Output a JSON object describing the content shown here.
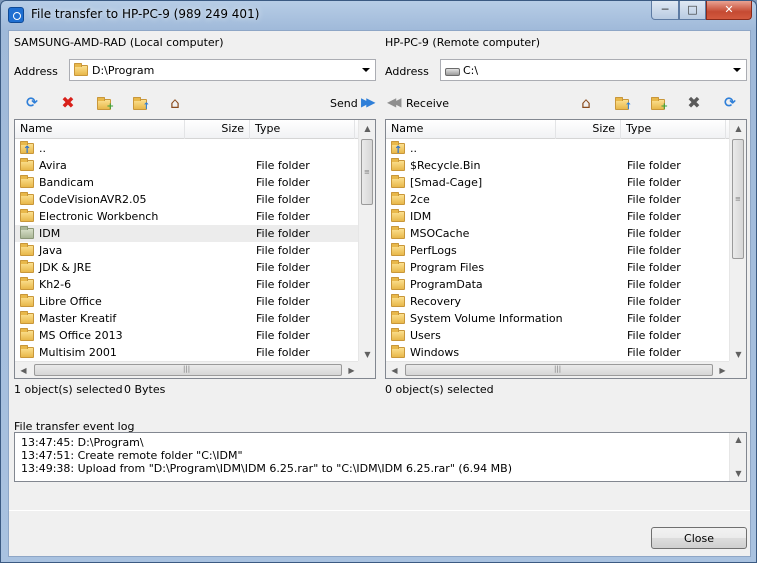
{
  "window": {
    "title": "File transfer to HP-PC-9 (989 249 401)"
  },
  "local": {
    "header": "SAMSUNG-AMD-RAD (Local computer)",
    "address_label": "Address",
    "address": "D:\\Program",
    "send_label": "Send",
    "columns": {
      "name": "Name",
      "size": "Size",
      "type": "Type"
    },
    "rows": [
      {
        "name": "..",
        "type": ""
      },
      {
        "name": "Avira",
        "type": "File folder"
      },
      {
        "name": "Bandicam",
        "type": "File folder"
      },
      {
        "name": "CodeVisionAVR2.05",
        "type": "File folder"
      },
      {
        "name": "Electronic Workbench",
        "type": "File folder"
      },
      {
        "name": "IDM",
        "type": "File folder"
      },
      {
        "name": "Java",
        "type": "File folder"
      },
      {
        "name": "JDK & JRE",
        "type": "File folder"
      },
      {
        "name": "Kh2-6",
        "type": "File folder"
      },
      {
        "name": "Libre Office",
        "type": "File folder"
      },
      {
        "name": "Master Kreatif",
        "type": "File folder"
      },
      {
        "name": "MS Office 2013",
        "type": "File folder"
      },
      {
        "name": "Multisim 2001",
        "type": "File folder"
      }
    ],
    "status_count": "1 object(s) selected",
    "status_size": "0 Bytes"
  },
  "remote": {
    "header": "HP-PC-9 (Remote computer)",
    "address_label": "Address",
    "address": "C:\\",
    "receive_label": "Receive",
    "columns": {
      "name": "Name",
      "size": "Size",
      "type": "Type"
    },
    "rows": [
      {
        "name": "..",
        "type": ""
      },
      {
        "name": "$Recycle.Bin",
        "type": "File folder"
      },
      {
        "name": "[Smad-Cage]",
        "type": "File folder"
      },
      {
        "name": "2ce",
        "type": "File folder"
      },
      {
        "name": "IDM",
        "type": "File folder"
      },
      {
        "name": "MSOCache",
        "type": "File folder"
      },
      {
        "name": "PerfLogs",
        "type": "File folder"
      },
      {
        "name": "Program Files",
        "type": "File folder"
      },
      {
        "name": "ProgramData",
        "type": "File folder"
      },
      {
        "name": "Recovery",
        "type": "File folder"
      },
      {
        "name": "System Volume Information",
        "type": "File folder"
      },
      {
        "name": "Users",
        "type": "File folder"
      },
      {
        "name": "Windows",
        "type": "File folder"
      }
    ],
    "status_count": "0 object(s) selected"
  },
  "log": {
    "label": "File transfer event log",
    "lines": [
      "13:47:45: D:\\Program\\",
      "13:47:51: Create remote folder \"C:\\IDM\"",
      "13:49:38: Upload from \"D:\\Program\\IDM\\IDM 6.25.rar\" to \"C:\\IDM\\IDM 6.25.rar\" (6.94 MB)"
    ]
  },
  "buttons": {
    "close": "Close"
  },
  "icons": {
    "refresh": "refresh-icon",
    "delete": "delete-icon",
    "new_folder": "new-folder-icon",
    "up_folder": "up-folder-icon",
    "home": "home-icon",
    "send": "send-arrows-icon",
    "receive": "receive-arrows-icon",
    "folder": "folder-icon",
    "drive": "drive-icon"
  },
  "colors": {
    "accent": "#2f7fd8",
    "delete_red": "#d8201a",
    "selection": "#ececec"
  }
}
